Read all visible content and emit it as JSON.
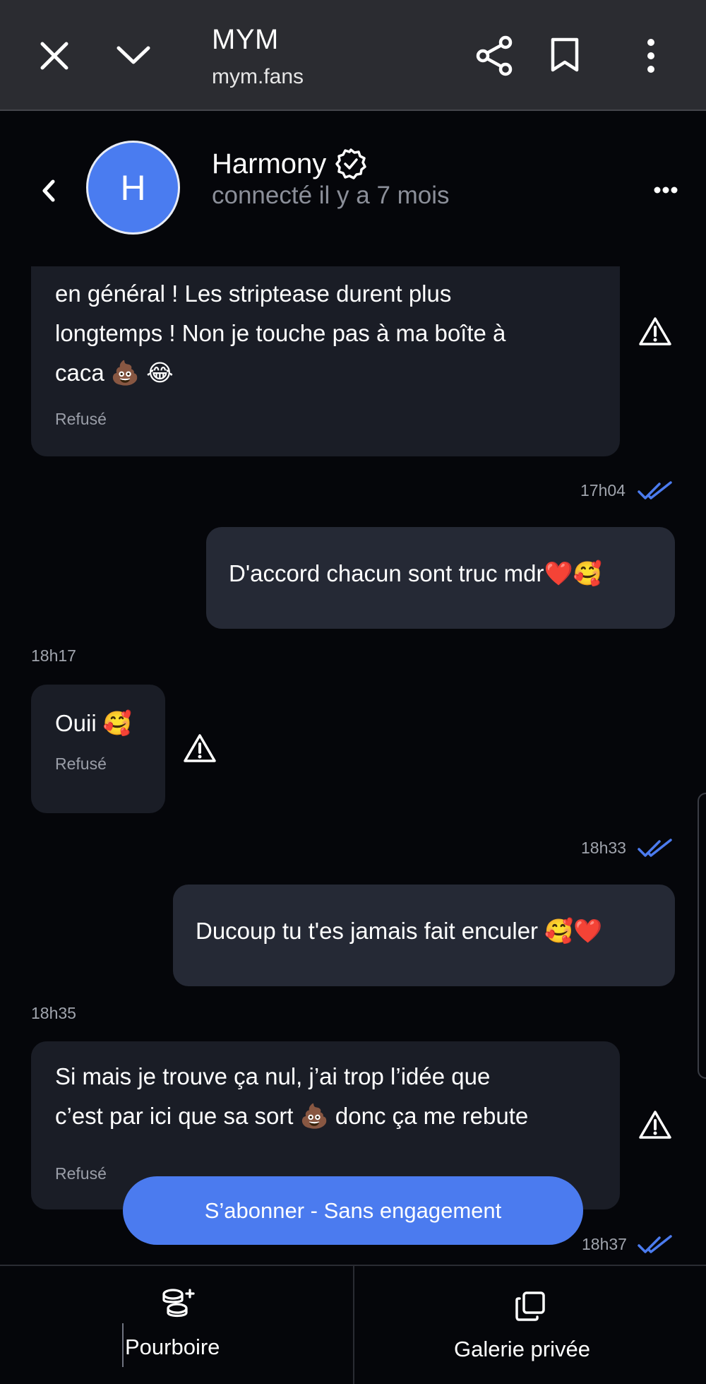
{
  "browser": {
    "title": "MYM",
    "url": "mym.fans",
    "icons": [
      "close-icon",
      "chevron-down-icon",
      "share-icon",
      "bookmark-icon",
      "more-vertical-icon"
    ]
  },
  "header": {
    "avatar_letter": "H",
    "name": "Harmony",
    "status": "connecté il y a 7 mois",
    "avatar_color": "#4a7cf0"
  },
  "messages": [
    {
      "direction": "in",
      "lines": [
        "en général ! Les striptease durent plus",
        "longtemps ! Non je touche pas à ma boîte à",
        "caca 💩 😂"
      ],
      "status": "Refusé"
    },
    {
      "direction": "out",
      "time": "17h04",
      "text": "D'accord chacun sont truc mdr❤️🥰"
    },
    {
      "direction": "in",
      "time": "18h17",
      "lines": [
        "Ouii 🥰"
      ],
      "status": "Refusé"
    },
    {
      "direction": "out",
      "time": "18h33",
      "text": "Ducoup tu t'es jamais fait enculer 🥰❤️"
    },
    {
      "direction": "in",
      "time": "18h35",
      "lines": [
        "Si mais je trouve ça nul, j’ai trop l’idée que",
        "c’est par ici que sa sort 💩 donc ça me rebute"
      ],
      "status": "Refusé"
    },
    {
      "direction": "out",
      "time": "18h37"
    }
  ],
  "subscribe_label": "S’abonner - Sans engagement",
  "bottom": {
    "tip_label": "Pourboire",
    "gallery_label": "Galerie privée"
  },
  "colors": {
    "accent": "#4b7bef",
    "background": "#05060a",
    "bubble_in": "#1a1d26",
    "bubble_out": "#252935",
    "read_ticks": "#4b7bef"
  }
}
